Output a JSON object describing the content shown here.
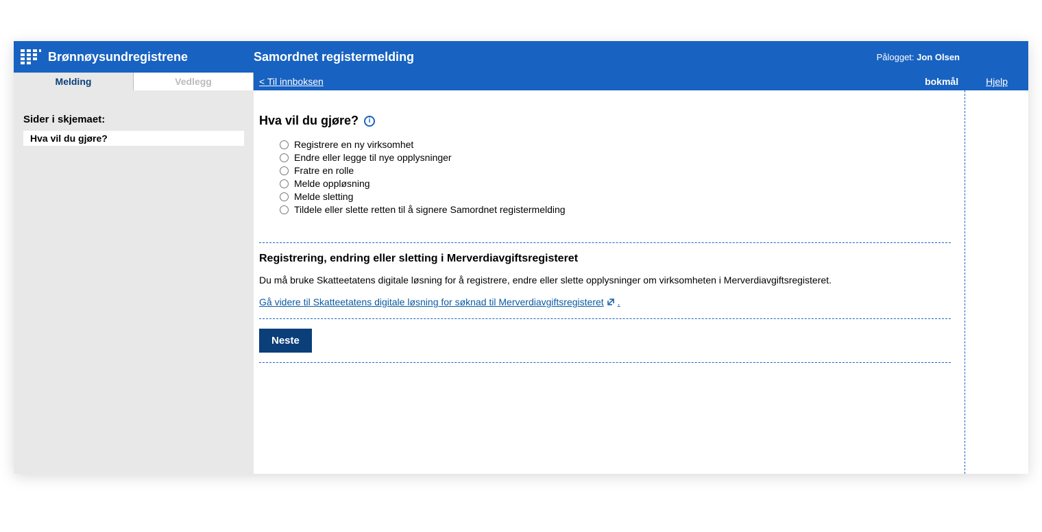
{
  "header": {
    "brand": "Brønnøysundregistrene",
    "title": "Samordnet registermelding",
    "logged_in_prefix": "Pålogget: ",
    "logged_in_user": "Jon Olsen"
  },
  "tabs": {
    "active": "Melding",
    "inactive": "Vedlegg"
  },
  "subheader": {
    "inbox_link": "< Til innboksen",
    "language": "bokmål",
    "help": "Hjelp"
  },
  "sidebar": {
    "title": "Sider i skjemaet:",
    "item": "Hva vil du gjøre?"
  },
  "main": {
    "question": "Hva vil du gjøre?",
    "options": [
      "Registrere en ny virksomhet",
      "Endre eller legge til nye opplysninger",
      "Fratre en rolle",
      "Melde oppløsning",
      "Melde sletting",
      "Tildele eller slette retten til å signere Samordnet registermelding"
    ],
    "mva_heading": "Registrering, endring eller sletting i Merverdiavgiftsregisteret",
    "mva_text": "Du må bruke Skatteetatens digitale løsning for å registrere, endre eller slette opplysninger om virksomheten i Merverdiavgiftsregisteret.",
    "mva_link": "Gå videre til Skatteetatens digitale løsning for søknad til Merverdiavgiftsregisteret",
    "next_button": "Neste"
  }
}
